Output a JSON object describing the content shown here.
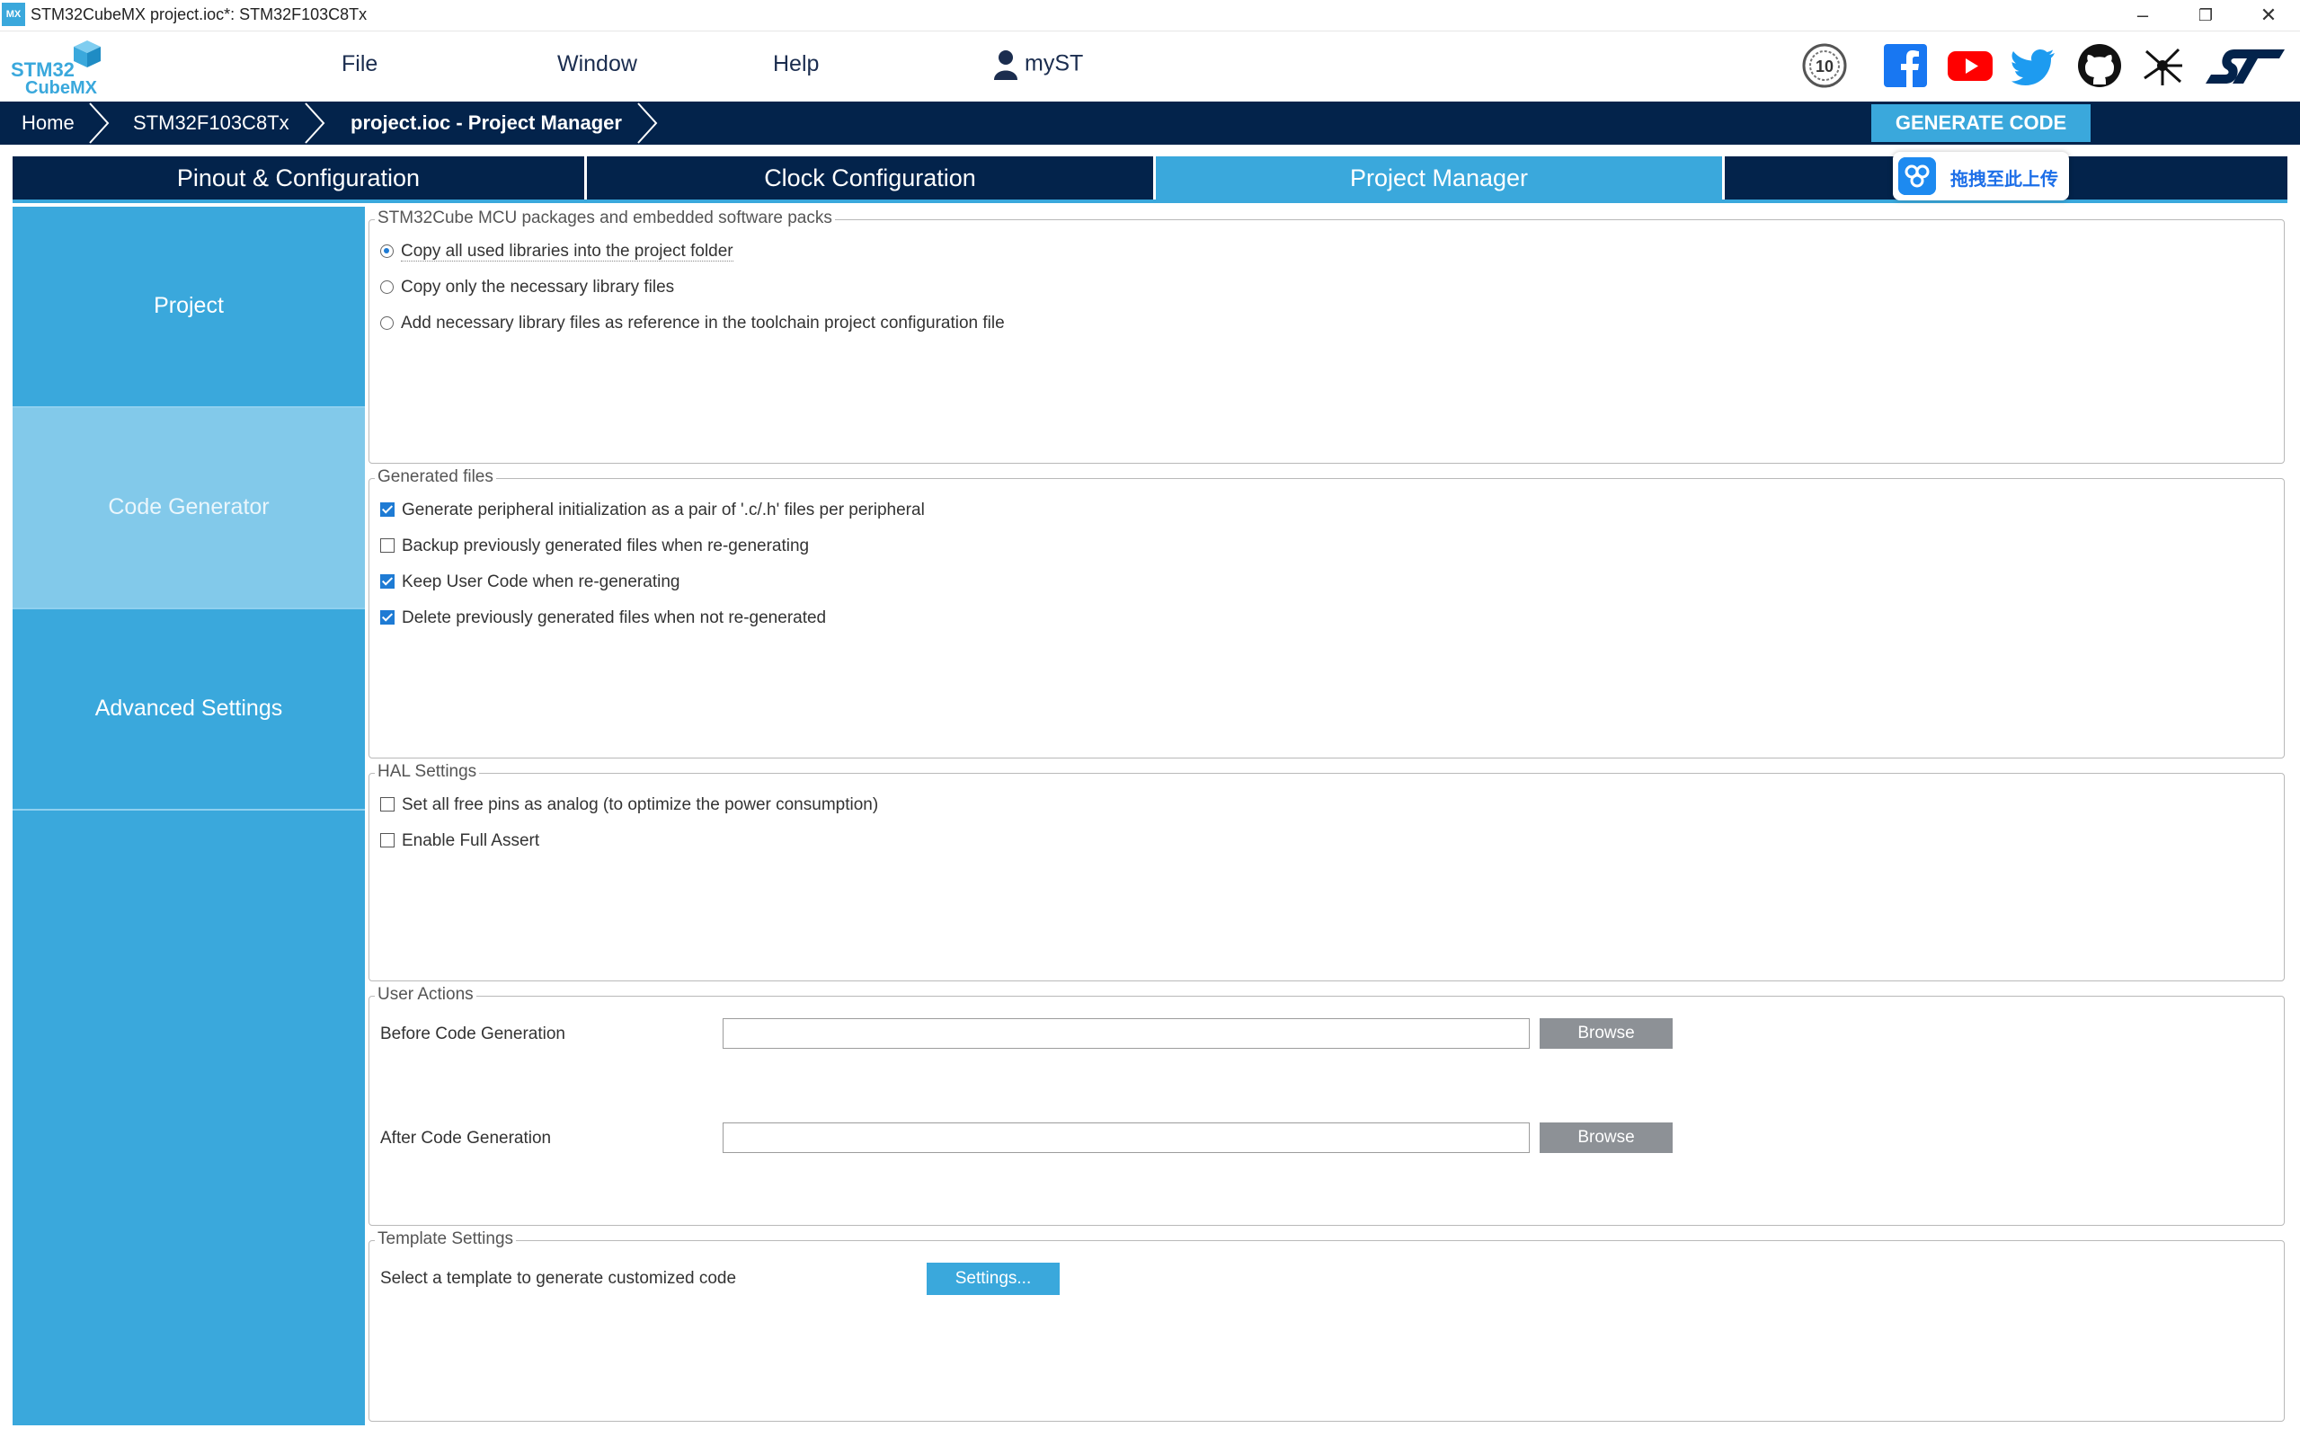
{
  "window": {
    "app_icon": "MX",
    "title": "STM32CubeMX project.ioc*: STM32F103C8Tx",
    "minimize": "–",
    "maximize": "❐",
    "close": "✕"
  },
  "logo": {
    "line1": "STM32",
    "line2": "CubeMX"
  },
  "menu": {
    "file": "File",
    "window": "Window",
    "help": "Help",
    "myst": "myST"
  },
  "social_icons": [
    "ten-years-badge-icon",
    "facebook-icon",
    "youtube-icon",
    "twitter-icon",
    "github-icon",
    "network-icon",
    "st-logo-icon"
  ],
  "breadcrumb": {
    "home": "Home",
    "mcu": "STM32F103C8Tx",
    "current": "project.ioc - Project Manager"
  },
  "generate_code_label": "GENERATE CODE",
  "tabs": {
    "pinout": "Pinout & Configuration",
    "clock": "Clock Configuration",
    "project_manager": "Project Manager"
  },
  "baidu_overlay": {
    "label": "拖拽至此上传"
  },
  "sidebar": {
    "project": "Project",
    "code_generator": "Code Generator",
    "advanced": "Advanced Settings"
  },
  "packages": {
    "legend": "STM32Cube MCU packages and embedded software packs",
    "opt1": "Copy all used libraries into the project folder",
    "opt2": "Copy only the necessary library files",
    "opt3": "Add necessary library files as reference in the toolchain project configuration file",
    "selected": 1
  },
  "generated_files": {
    "legend": "Generated files",
    "opt1": "Generate peripheral initialization as a pair of '.c/.h' files per peripheral",
    "opt2": "Backup previously generated files when re-generating",
    "opt3": "Keep User Code when re-generating",
    "opt4": "Delete previously generated files when not re-generated",
    "checked": [
      true,
      false,
      true,
      true
    ]
  },
  "hal": {
    "legend": "HAL Settings",
    "opt1": "Set all free pins as analog (to optimize the power consumption)",
    "opt2": "Enable Full Assert",
    "checked": [
      false,
      false
    ]
  },
  "user_actions": {
    "legend": "User Actions",
    "before_label": "Before Code Generation",
    "before_value": "",
    "after_label": "After Code Generation",
    "after_value": "",
    "browse": "Browse"
  },
  "template": {
    "legend": "Template Settings",
    "label": "Select a template to generate customized code",
    "button": "Settings..."
  },
  "colors": {
    "navy": "#03234b",
    "accent": "#3aa8dc",
    "sidebar_active": "#82c9ea",
    "browse_gray": "#8d9196"
  }
}
